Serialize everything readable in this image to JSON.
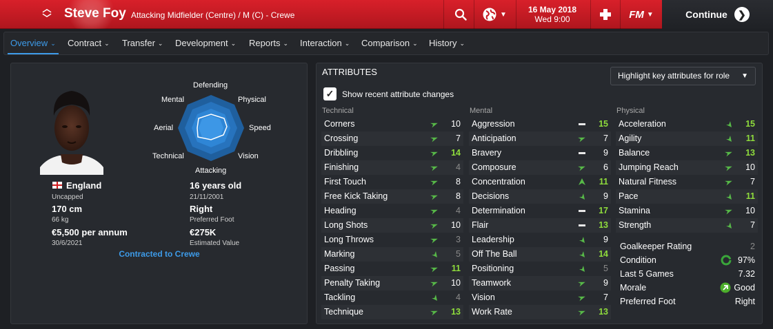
{
  "header": {
    "player_name": "Steve Foy",
    "player_subtitle": "Attacking Midfielder (Centre) / M (C) - Crewe",
    "date": "16 May 2018",
    "day_time": "Wed 9:00",
    "continue_label": "Continue",
    "fm_label": "FM",
    "accent_color": "#c81a24"
  },
  "nav": {
    "tabs": [
      {
        "label": "Overview",
        "active": true
      },
      {
        "label": "Contract"
      },
      {
        "label": "Transfer"
      },
      {
        "label": "Development"
      },
      {
        "label": "Reports"
      },
      {
        "label": "Interaction"
      },
      {
        "label": "Comparison"
      },
      {
        "label": "History"
      }
    ]
  },
  "profile": {
    "nationality": "England",
    "caps": "Uncapped",
    "height": "170 cm",
    "weight": "66 kg",
    "wage": "€5,500 per annum",
    "contract_end": "30/6/2021",
    "age": "16 years old",
    "dob": "21/11/2001",
    "preferred_foot": "Right",
    "preferred_foot_label": "Preferred Foot",
    "value": "€275K",
    "value_label": "Estimated Value",
    "contracted": "Contracted to Crewe"
  },
  "radar": {
    "labels": {
      "defending": "Defending",
      "physical": "Physical",
      "speed": "Speed",
      "vision": "Vision",
      "attacking": "Attacking",
      "technical": "Technical",
      "aerial": "Aerial",
      "mental": "Mental"
    }
  },
  "attributes": {
    "title": "ATTRIBUTES",
    "highlight_select": "Highlight key attributes for role",
    "show_changes_label": "Show recent attribute changes",
    "show_changes_checked": true,
    "columns": [
      {
        "header": "Technical",
        "rows": [
          {
            "name": "Corners",
            "value": "10",
            "trend": "up",
            "style": "white"
          },
          {
            "name": "Crossing",
            "value": "7",
            "trend": "up",
            "style": "white"
          },
          {
            "name": "Dribbling",
            "value": "14",
            "trend": "up",
            "style": "green"
          },
          {
            "name": "Finishing",
            "value": "4",
            "trend": "up",
            "style": "grey"
          },
          {
            "name": "First Touch",
            "value": "8",
            "trend": "up",
            "style": "white"
          },
          {
            "name": "Free Kick Taking",
            "value": "8",
            "trend": "up",
            "style": "white"
          },
          {
            "name": "Heading",
            "value": "4",
            "trend": "up",
            "style": "grey"
          },
          {
            "name": "Long Shots",
            "value": "10",
            "trend": "up",
            "style": "white"
          },
          {
            "name": "Long Throws",
            "value": "3",
            "trend": "up",
            "style": "grey"
          },
          {
            "name": "Marking",
            "value": "5",
            "trend": "up-left",
            "style": "grey"
          },
          {
            "name": "Passing",
            "value": "11",
            "trend": "up",
            "style": "green"
          },
          {
            "name": "Penalty Taking",
            "value": "10",
            "trend": "up",
            "style": "white"
          },
          {
            "name": "Tackling",
            "value": "4",
            "trend": "up-left",
            "style": "grey"
          },
          {
            "name": "Technique",
            "value": "13",
            "trend": "up",
            "style": "green"
          }
        ]
      },
      {
        "header": "Mental",
        "rows": [
          {
            "name": "Aggression",
            "value": "15",
            "trend": "flat",
            "style": "green"
          },
          {
            "name": "Anticipation",
            "value": "7",
            "trend": "up",
            "style": "white"
          },
          {
            "name": "Bravery",
            "value": "9",
            "trend": "flat",
            "style": "white"
          },
          {
            "name": "Composure",
            "value": "6",
            "trend": "up",
            "style": "white"
          },
          {
            "name": "Concentration",
            "value": "11",
            "trend": "up-steep",
            "style": "green"
          },
          {
            "name": "Decisions",
            "value": "9",
            "trend": "up-left",
            "style": "white"
          },
          {
            "name": "Determination",
            "value": "17",
            "trend": "flat",
            "style": "green"
          },
          {
            "name": "Flair",
            "value": "13",
            "trend": "flat",
            "style": "green"
          },
          {
            "name": "Leadership",
            "value": "9",
            "trend": "up-left",
            "style": "white"
          },
          {
            "name": "Off The Ball",
            "value": "14",
            "trend": "up-left",
            "style": "green"
          },
          {
            "name": "Positioning",
            "value": "5",
            "trend": "up-left",
            "style": "grey"
          },
          {
            "name": "Teamwork",
            "value": "9",
            "trend": "up",
            "style": "white"
          },
          {
            "name": "Vision",
            "value": "7",
            "trend": "up",
            "style": "white"
          },
          {
            "name": "Work Rate",
            "value": "13",
            "trend": "up",
            "style": "green"
          }
        ]
      },
      {
        "header": "Physical",
        "rows": [
          {
            "name": "Acceleration",
            "value": "15",
            "trend": "up-left",
            "style": "green"
          },
          {
            "name": "Agility",
            "value": "11",
            "trend": "up-left",
            "style": "green"
          },
          {
            "name": "Balance",
            "value": "13",
            "trend": "up",
            "style": "green"
          },
          {
            "name": "Jumping Reach",
            "value": "10",
            "trend": "up",
            "style": "white"
          },
          {
            "name": "Natural Fitness",
            "value": "7",
            "trend": "up",
            "style": "white"
          },
          {
            "name": "Pace",
            "value": "11",
            "trend": "up-left",
            "style": "green"
          },
          {
            "name": "Stamina",
            "value": "10",
            "trend": "up",
            "style": "white"
          },
          {
            "name": "Strength",
            "value": "7",
            "trend": "up-left",
            "style": "white"
          }
        ]
      }
    ],
    "misc": [
      {
        "name": "Goalkeeper Rating",
        "value": "2",
        "style": "grey"
      },
      {
        "name": "Condition",
        "value": "97%",
        "icon": "condition-ring-icon"
      },
      {
        "name": "Last 5 Games",
        "value": "7.32"
      },
      {
        "name": "Morale",
        "value": "Good",
        "icon": "morale-arrow-icon"
      },
      {
        "name": "Preferred Foot",
        "value": "Right"
      }
    ]
  }
}
